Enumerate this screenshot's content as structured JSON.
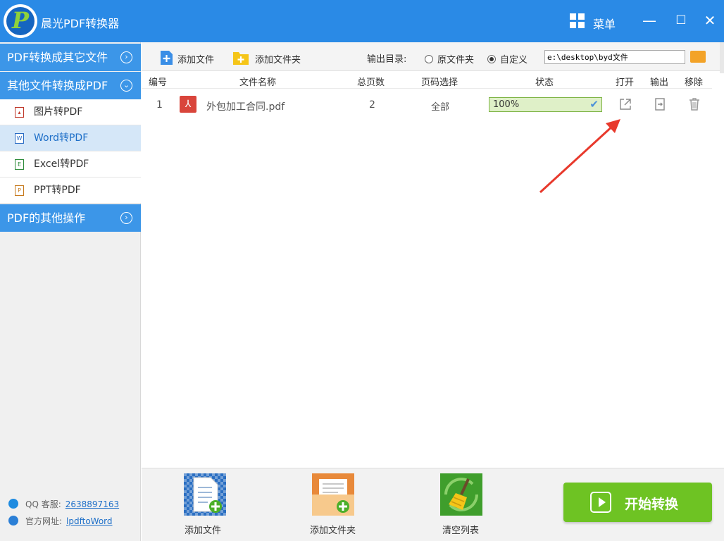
{
  "app": {
    "title": "晨光PDF转换器",
    "menu_label": "菜单"
  },
  "window_controls": {
    "minimize": "—",
    "maximize": "☐",
    "close": "✕"
  },
  "sidebar": {
    "sections": [
      {
        "label": "PDF转换成其它文件",
        "chevron": "›"
      },
      {
        "label": "其他文件转换成PDF",
        "chevron": "⌄"
      },
      {
        "label": "PDF的其他操作",
        "chevron": "›"
      }
    ],
    "items": [
      {
        "label": "图片转PDF",
        "icon": "image-file-icon"
      },
      {
        "label": "Word转PDF",
        "icon": "word-file-icon",
        "active": true
      },
      {
        "label": "Excel转PDF",
        "icon": "excel-file-icon"
      },
      {
        "label": "PPT转PDF",
        "icon": "ppt-file-icon"
      }
    ],
    "contact": {
      "qq_label": "QQ 客服:",
      "qq_value": "2638897163",
      "site_label": "官方网址:",
      "site_value": "lpdftoWord"
    }
  },
  "toolbar": {
    "add_file": "添加文件",
    "add_folder": "添加文件夹",
    "output_dir_label": "输出目录:",
    "option_original": "原文件夹",
    "option_custom": "自定义",
    "output_path": "e:\\desktop\\byd文件"
  },
  "table": {
    "headers": [
      "编号",
      "文件名称",
      "总页数",
      "页码选择",
      "状态",
      "打开",
      "输出",
      "移除"
    ],
    "rows": [
      {
        "index": "1",
        "filename": "外包加工合同.pdf",
        "pages": "2",
        "page_select": "全部",
        "status": "100%",
        "progress": 1.0
      }
    ]
  },
  "bottom": {
    "add_file": "添加文件",
    "add_folder": "添加文件夹",
    "clear_list": "清空列表",
    "start": "开始转换"
  },
  "colors": {
    "brand_blue": "#2a8ae6",
    "sidebar_blue": "#3c96e8",
    "start_green": "#6ec323",
    "annotation_red": "#e8392c"
  }
}
